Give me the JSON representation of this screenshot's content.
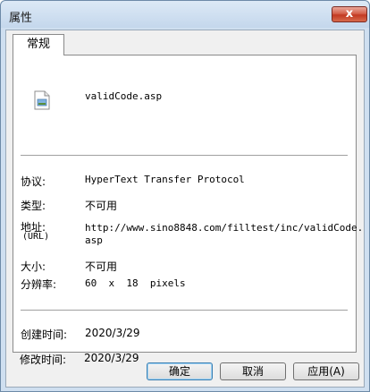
{
  "window": {
    "title": "属性",
    "close_glyph": "x"
  },
  "tab": {
    "label": "常规"
  },
  "file": {
    "icon": "document-icon",
    "name": "validCode.asp"
  },
  "props": {
    "protocol": {
      "label": "协议:",
      "value": "HyperText Transfer Protocol"
    },
    "type": {
      "label": "类型:",
      "value": "不可用"
    },
    "address": {
      "label": "地址:",
      "sublabel": "(URL)",
      "value_line1": "http://www.sino8848.com/filltest/inc/validCode.",
      "value_line2": "asp"
    },
    "size": {
      "label": "大小:",
      "value": "不可用"
    },
    "resolution": {
      "label": "分辨率:",
      "value": "60  x  18  pixels"
    },
    "created": {
      "label": "创建时间:",
      "value": "2020/3/29"
    },
    "modified": {
      "label": "修改时间:",
      "value": "2020/3/29"
    }
  },
  "buttons": {
    "ok": "确定",
    "cancel": "取消",
    "apply": "应用(A)"
  }
}
